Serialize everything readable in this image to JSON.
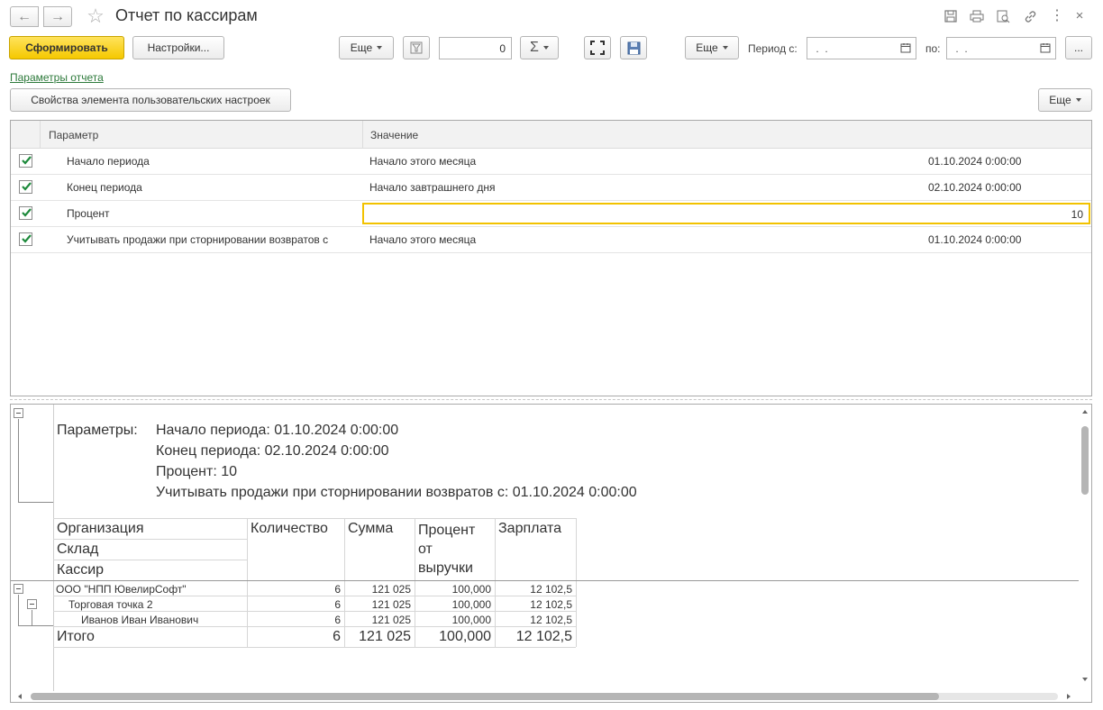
{
  "window": {
    "title": "Отчет по кассирам"
  },
  "toolbar": {
    "generate_label": "Сформировать",
    "settings_label": "Настройки...",
    "more_label": "Еще",
    "number_value": "0",
    "sum_symbol": "Σ",
    "period_from_label": "Период с:",
    "period_from_value": " .  .",
    "period_to_label": "по:",
    "period_to_value": " .  .",
    "ellipsis_label": "...",
    "more2_label": "Еще"
  },
  "params_link": "Параметры отчета",
  "props_button": "Свойства элемента пользовательских настроек",
  "props_more": "Еще",
  "params_table": {
    "headers": [
      "Параметр",
      "Значение"
    ],
    "rows": [
      {
        "name": "Начало периода",
        "value": "Начало этого месяца",
        "extra": "01.10.2024 0:00:00"
      },
      {
        "name": "Конец периода",
        "value": "Начало завтрашнего дня",
        "extra": "02.10.2024 0:00:00"
      },
      {
        "name": "Процент",
        "value": "",
        "extra": "10"
      },
      {
        "name": "Учитывать продажи при сторнировании возвратов с",
        "value": "Начало этого месяца",
        "extra": "01.10.2024 0:00:00"
      }
    ]
  },
  "report": {
    "params_label": "Параметры:",
    "params_lines": [
      "Начало периода: 01.10.2024 0:00:00",
      "Конец периода: 02.10.2024 0:00:00",
      "Процент: 10",
      "Учитывать продажи при сторнировании возвратов с: 01.10.2024 0:00:00"
    ],
    "group_headers": [
      "Организация",
      "Склад",
      "Кассир"
    ],
    "col_headers": [
      "Количество",
      "Сумма",
      "Процент от выручки",
      "Зарплата"
    ],
    "col_header_lines": [
      [
        "Количество"
      ],
      [
        "Сумма"
      ],
      [
        "Процент",
        "от",
        "выручки"
      ],
      [
        "Зарплата"
      ]
    ],
    "rows": [
      {
        "name": "ООО \"НПП ЮвелирСофт\"",
        "qty": "6",
        "sum": "121 025",
        "pct": "100,000",
        "salary": "12 102,5"
      },
      {
        "name": "Торговая точка 2",
        "qty": "6",
        "sum": "121 025",
        "pct": "100,000",
        "salary": "12 102,5"
      },
      {
        "name": "Иванов Иван Иванович",
        "qty": "6",
        "sum": "121 025",
        "pct": "100,000",
        "salary": "12 102,5"
      }
    ],
    "total": {
      "name": "Итого",
      "qty": "6",
      "sum": "121 025",
      "pct": "100,000",
      "salary": "12 102,5"
    }
  }
}
